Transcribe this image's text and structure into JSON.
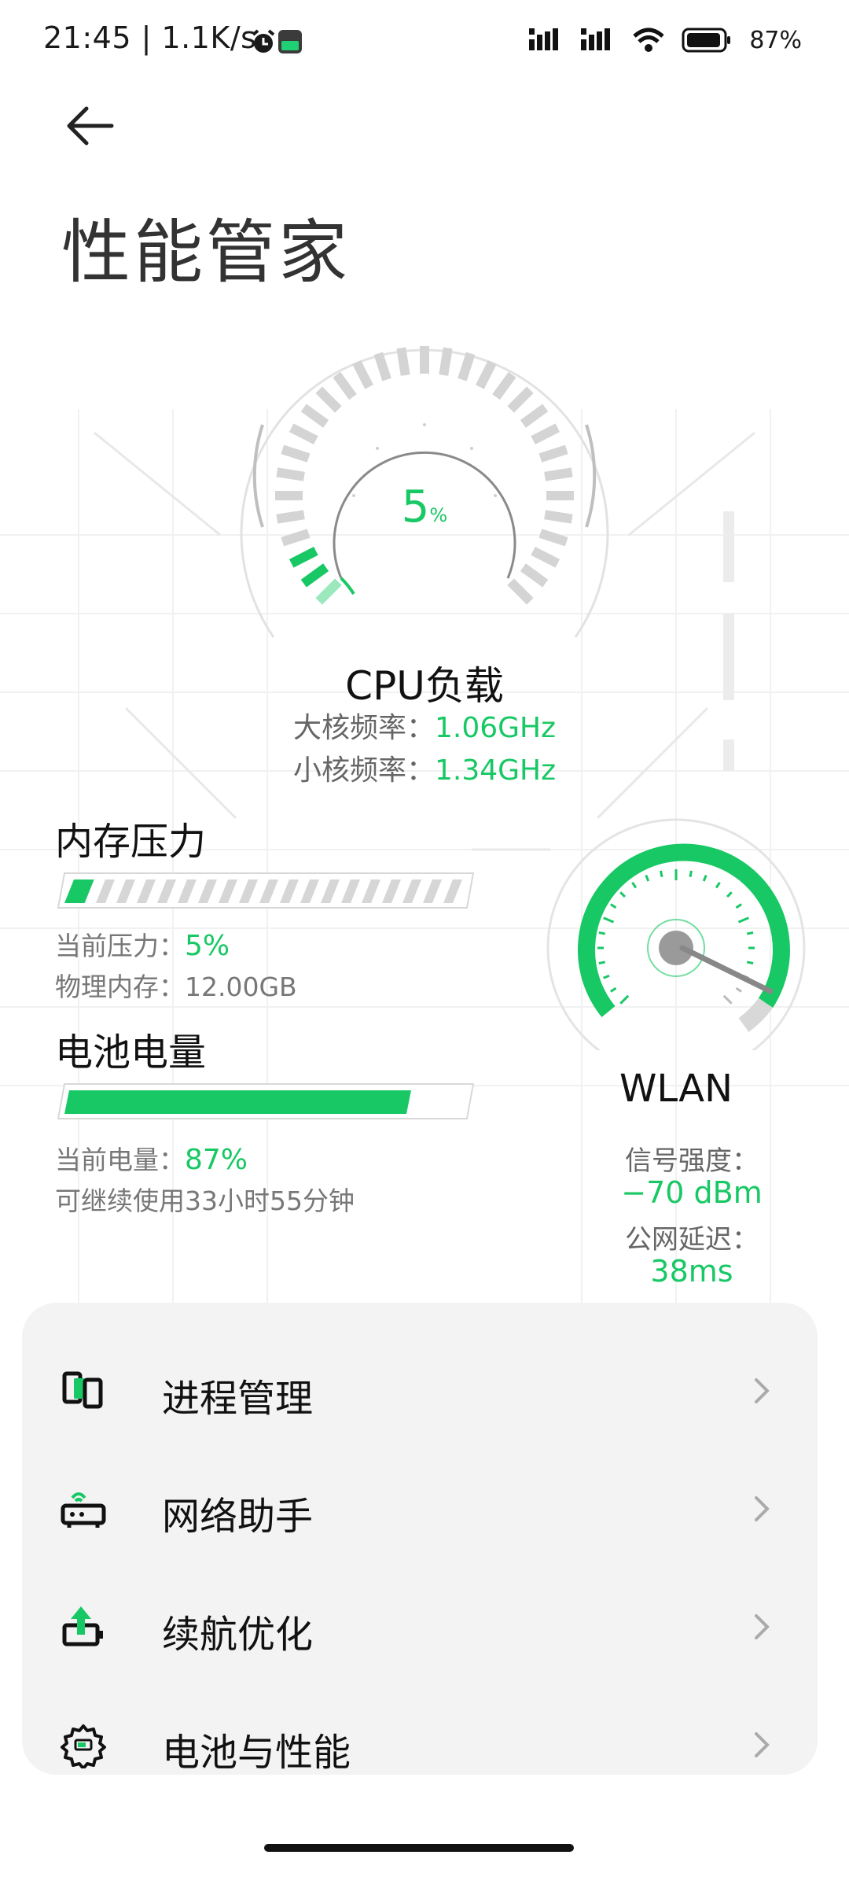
{
  "status_bar": {
    "time_speed": "21:45 | 1.1K/s",
    "battery_percent": "87%"
  },
  "page": {
    "title": "性能管家"
  },
  "cpu": {
    "load_value": "5",
    "load_unit": "%",
    "label": "CPU负载",
    "big_core_label": "大核频率：",
    "big_core_value": "1.06GHz",
    "little_core_label": "小核频率：",
    "little_core_value": "1.34GHz"
  },
  "memory": {
    "title": "内存压力",
    "pressure_label": "当前压力：",
    "pressure_value": "5%",
    "pressure_fraction": 0.05,
    "physical_label": "物理内存：12.00GB"
  },
  "battery": {
    "title": "电池电量",
    "level_label": "当前电量：",
    "level_value": "87%",
    "level_fraction": 0.87,
    "remaining": "可继续使用33小时55分钟"
  },
  "wlan": {
    "label": "WLAN",
    "signal_label": "信号强度：",
    "signal_value": "−70 dBm",
    "latency_label": "公网延迟：",
    "latency_value": "38ms"
  },
  "menu": {
    "items": [
      {
        "label": "进程管理",
        "icon": "process-icon"
      },
      {
        "label": "网络助手",
        "icon": "router-icon"
      },
      {
        "label": "续航优化",
        "icon": "battery-boost-icon"
      },
      {
        "label": "电池与性能",
        "icon": "gear-icon"
      }
    ]
  },
  "colors": {
    "accent": "#18c864",
    "accent_light": "#9be8bd",
    "card_bg": "#f3f3f3"
  }
}
